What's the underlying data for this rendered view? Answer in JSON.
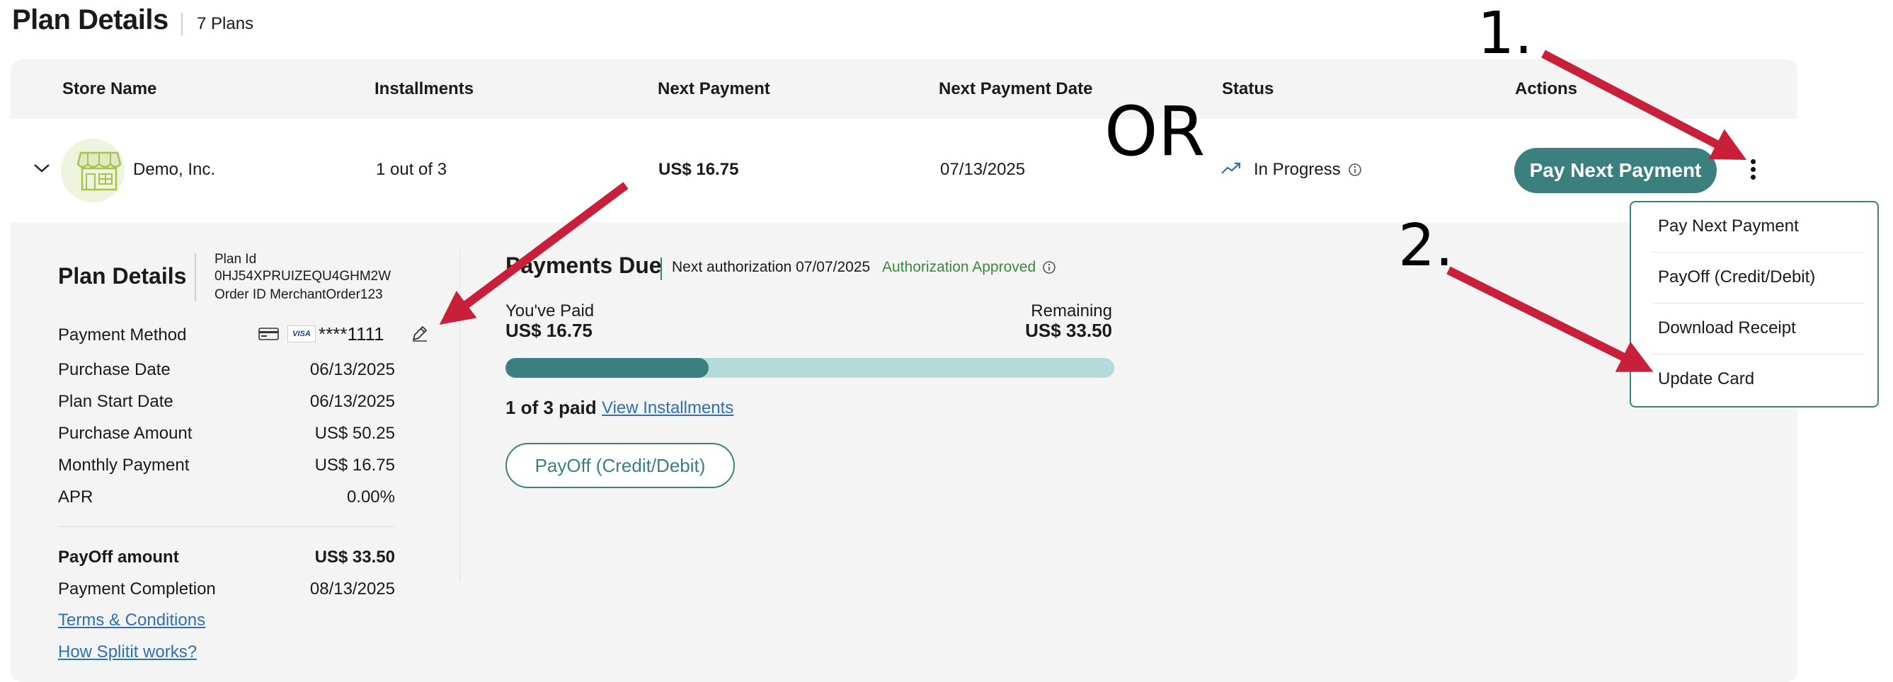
{
  "header": {
    "title": "Plan Details",
    "plan_count": "7 Plans"
  },
  "table": {
    "columns": [
      "Store Name",
      "Installments",
      "Next Payment",
      "Next Payment Date",
      "Status",
      "Actions"
    ],
    "row": {
      "store_name": "Demo, Inc.",
      "installments": "1 out of 3",
      "next_payment": "US$ 16.75",
      "next_payment_date": "07/13/2025",
      "status": "In Progress",
      "action_button": "Pay Next Payment"
    }
  },
  "menu": {
    "items": [
      "Pay Next Payment",
      "PayOff (Credit/Debit)",
      "Download Receipt",
      "Update Card"
    ]
  },
  "plan_details": {
    "title": "Plan Details",
    "plan_id_label": "Plan Id",
    "plan_id_value": "0HJ54XPRUIZEQU4GHM2W",
    "order_id": "Order ID MerchantOrder123",
    "payment_method_label": "Payment Method",
    "visa_badge": "VISA",
    "card_digits": "****1111",
    "rows": [
      {
        "label": "Purchase Date",
        "value": "06/13/2025"
      },
      {
        "label": "Plan Start Date",
        "value": "06/13/2025"
      },
      {
        "label": "Purchase Amount",
        "value": "US$ 50.25"
      },
      {
        "label": "Monthly Payment",
        "value": "US$ 16.75"
      },
      {
        "label": "APR",
        "value": "0.00%"
      }
    ],
    "payoff_label": "PayOff amount",
    "payoff_value": "US$ 33.50",
    "completion_label": "Payment Completion",
    "completion_value": "08/13/2025",
    "terms_link": "Terms & Conditions",
    "how_link": "How Splitit works?"
  },
  "payments_due": {
    "title": "Payments Due",
    "next_auth": "Next authorization 07/07/2025",
    "auth_status": "Authorization Approved",
    "paid_label": "You've Paid",
    "paid_value": "US$ 16.75",
    "remaining_label": "Remaining",
    "remaining_value": "US$ 33.50",
    "progress_fraction": 0.3333,
    "paid_count": "1 of 3 paid",
    "view_link": "View Installments",
    "payoff_button": "PayOff (Credit/Debit)"
  },
  "annotations": {
    "step1": "1.",
    "or": "OR",
    "step2": "2."
  },
  "colors": {
    "teal": "#3b7f7f",
    "teal_light": "#b5dada",
    "arrow": "#c8203a",
    "link": "#2e6fb5",
    "approved": "#3a8a3a"
  }
}
